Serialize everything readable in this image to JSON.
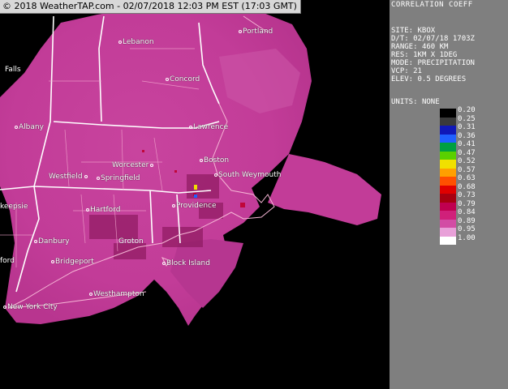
{
  "banner": "© 2018 WeatherTAP.com - 02/07/2018 12:03 PM EST (17:03 GMT)",
  "panel": {
    "title": "CORRELATION COEFF",
    "meta": [
      {
        "label": "SITE:",
        "value": "KBOX"
      },
      {
        "label": "D/T:",
        "value": "02/07/18 1703Z"
      },
      {
        "label": "RANGE:",
        "value": "460 KM"
      },
      {
        "label": "RES:",
        "value": "1KM X 1DEG"
      },
      {
        "label": "MODE:",
        "value": "PRECIPITATION"
      },
      {
        "label": "VCP:",
        "value": "21"
      },
      {
        "label": "ELEV:",
        "value": "0.5 DEGREES"
      }
    ],
    "units_label": "UNITS:",
    "units_value": "NONE",
    "scale": [
      {
        "value": "0.20",
        "color": "#000000"
      },
      {
        "value": "0.25",
        "color": "#3a3a3a"
      },
      {
        "value": "0.31",
        "color": "#1018b8"
      },
      {
        "value": "0.36",
        "color": "#2060ff"
      },
      {
        "value": "0.41",
        "color": "#00a040"
      },
      {
        "value": "0.47",
        "color": "#5ad000"
      },
      {
        "value": "0.52",
        "color": "#f0e000"
      },
      {
        "value": "0.57",
        "color": "#ffa000"
      },
      {
        "value": "0.63",
        "color": "#ff5000"
      },
      {
        "value": "0.68",
        "color": "#e00000"
      },
      {
        "value": "0.73",
        "color": "#a80010"
      },
      {
        "value": "0.79",
        "color": "#c00050"
      },
      {
        "value": "0.84",
        "color": "#d0207a"
      },
      {
        "value": "0.89",
        "color": "#d24ca4"
      },
      {
        "value": "0.95",
        "color": "#e8a0d8"
      },
      {
        "value": "1.00",
        "color": "#ffffff"
      }
    ]
  },
  "cities": [
    {
      "name": "Portland",
      "id": "portland"
    },
    {
      "name": "Lebanon",
      "id": "lebanon"
    },
    {
      "name": "Falls",
      "id": "falls"
    },
    {
      "name": "Concord",
      "id": "concord"
    },
    {
      "name": "Albany",
      "id": "albany"
    },
    {
      "name": "Lawrence",
      "id": "lawrence"
    },
    {
      "name": "Worcester",
      "id": "worcester"
    },
    {
      "name": "Boston",
      "id": "boston"
    },
    {
      "name": "Westfield",
      "id": "westfield"
    },
    {
      "name": "Springfield",
      "id": "springfield"
    },
    {
      "name": "South Weymouth",
      "id": "south-weymouth"
    },
    {
      "name": "Providence",
      "id": "providence"
    },
    {
      "name": "Hartford",
      "id": "hartford"
    },
    {
      "name": "keepsie",
      "id": "keepsie"
    },
    {
      "name": "Danbury",
      "id": "danbury"
    },
    {
      "name": "Groton",
      "id": "groton"
    },
    {
      "name": "Block Island",
      "id": "block-island"
    },
    {
      "name": "Bridgeport",
      "id": "bridgeport"
    },
    {
      "name": "ford",
      "id": "ford"
    },
    {
      "name": "Westhampton",
      "id": "westhampton"
    },
    {
      "name": "New York City",
      "id": "new-york-city"
    }
  ],
  "colors": {
    "echo": "#c8449e",
    "echo_dark": "#a8207a",
    "echo_light": "#d97ac0",
    "panel_bg": "#7f7f7f"
  }
}
